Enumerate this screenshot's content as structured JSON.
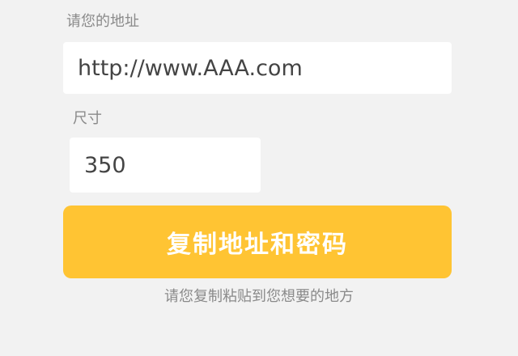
{
  "form": {
    "url_label": "请您的地址",
    "url_value": "http://www.AAA.com",
    "size_label": "尺寸",
    "size_value": "350",
    "copy_button_label": "复制地址和密码",
    "hint_text": "请您复制粘贴到您想要的地方"
  },
  "colors": {
    "background": "#f2f2f2",
    "accent": "#ffc433",
    "input_background": "#ffffff"
  }
}
